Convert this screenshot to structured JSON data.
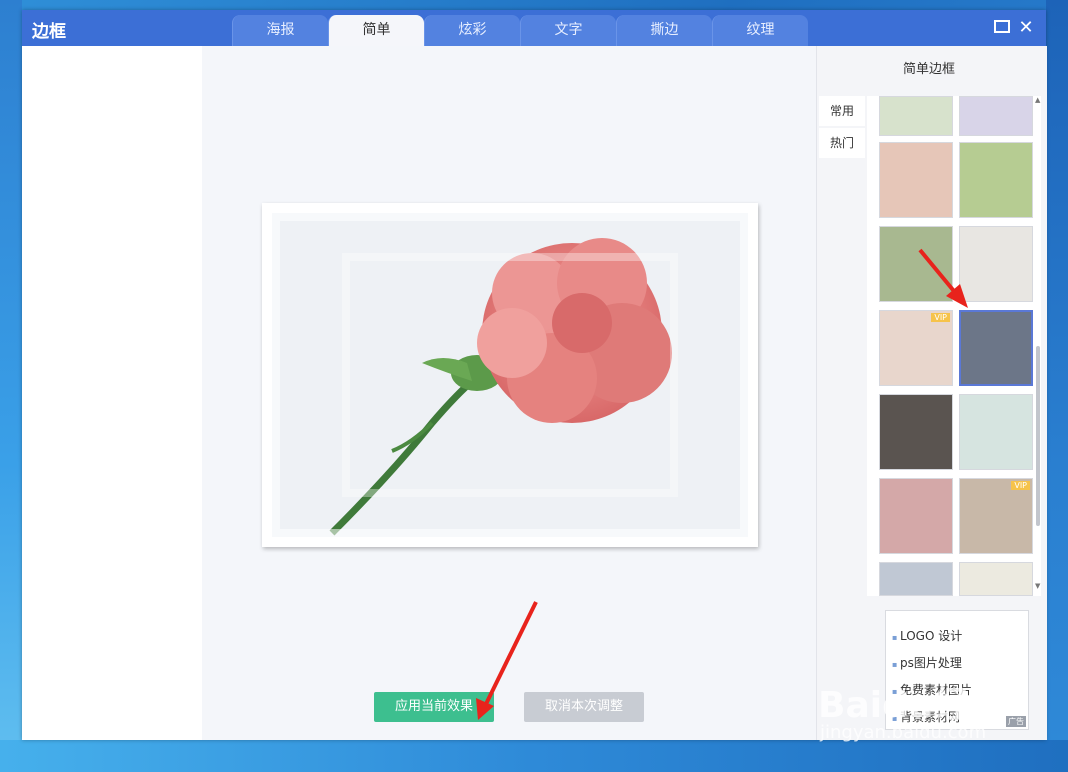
{
  "window": {
    "title": "边框",
    "tabs": [
      {
        "label": "海报"
      },
      {
        "label": "简单"
      },
      {
        "label": "炫彩"
      },
      {
        "label": "文字"
      },
      {
        "label": "撕边"
      },
      {
        "label": "纹理"
      }
    ],
    "active_tab": "简单",
    "maximize_glyph": "",
    "close_glyph": "✕"
  },
  "actions": {
    "apply_label": "应用当前效果",
    "cancel_label": "取消本次调整"
  },
  "sidebar": {
    "title": "简单边框",
    "categories": [
      {
        "label": "常用"
      },
      {
        "label": "热门"
      }
    ],
    "scroll_up": "▲",
    "scroll_down": "▼",
    "vip_badge": "VIP"
  },
  "ads": {
    "items": [
      {
        "label": "LOGO 设计"
      },
      {
        "label": "ps图片处理"
      },
      {
        "label": "免费素材图片"
      },
      {
        "label": "背景素材网"
      }
    ],
    "tag": "广告"
  },
  "watermark": {
    "brand": "Baidu经验",
    "url": "jingyan.baidu.com"
  },
  "colors": {
    "titlebar": "#3c6fd6",
    "apply_button": "#3dbf8f",
    "cancel_button": "#c8ccd3",
    "annotation_arrow": "#e8231c",
    "selected_border": "#5a78d6"
  }
}
